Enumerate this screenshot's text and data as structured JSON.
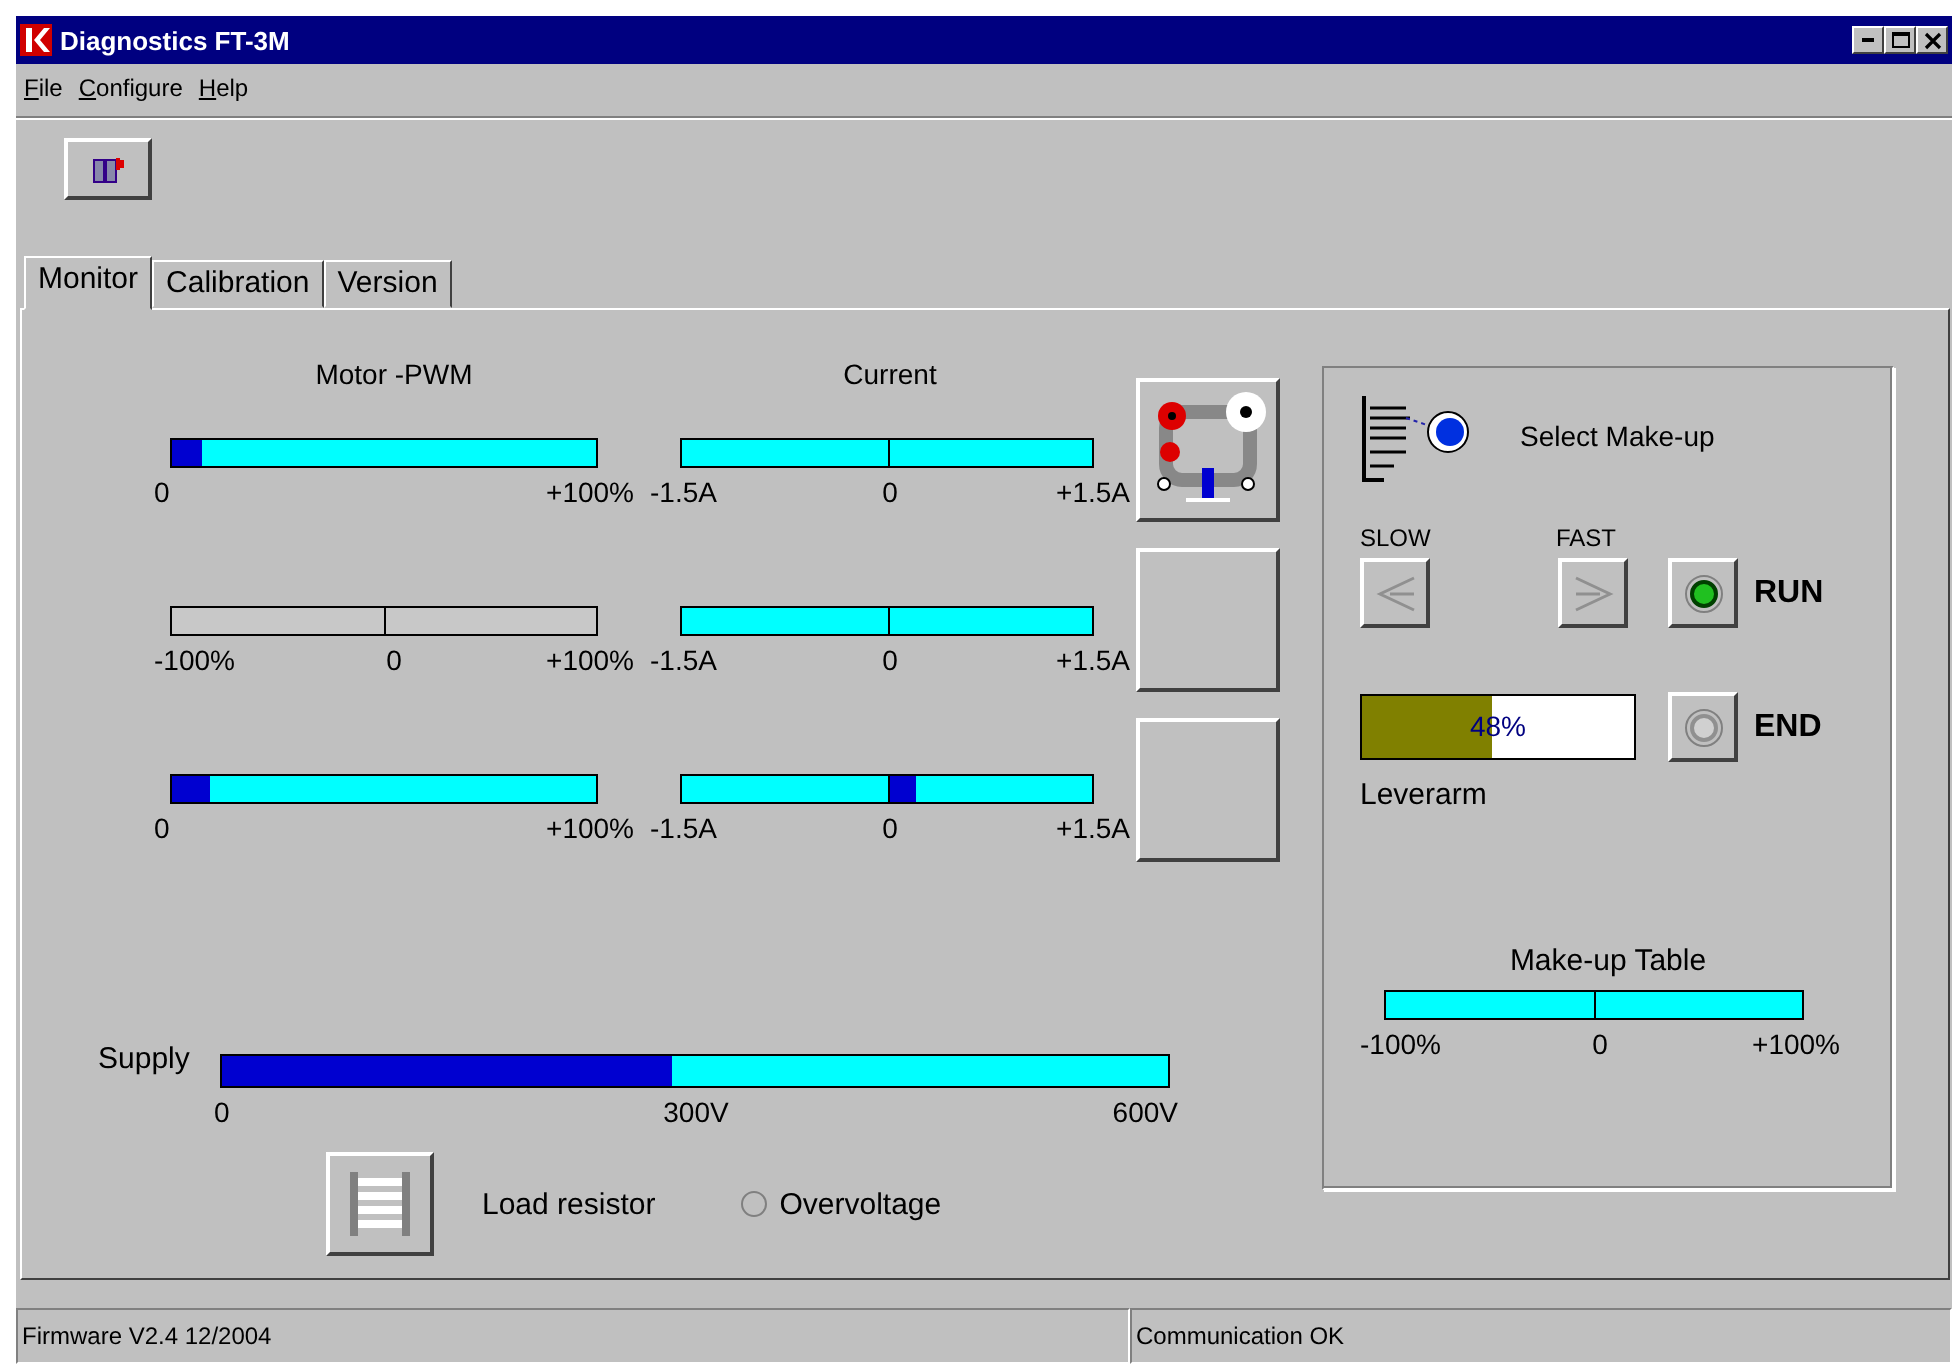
{
  "window": {
    "title": "Diagnostics FT-3M"
  },
  "menu": [
    {
      "label": "File"
    },
    {
      "label": "Configure"
    },
    {
      "label": "Help"
    }
  ],
  "tabs": [
    {
      "label": "Monitor",
      "selected": true
    },
    {
      "label": "Calibration",
      "selected": false
    },
    {
      "label": "Version",
      "selected": false
    }
  ],
  "motor_pwm": {
    "title": "Motor -PWM",
    "bars": [
      {
        "kind": "unipolar",
        "disabled": false,
        "level": 0.07,
        "scale": [
          "0",
          "+100%"
        ]
      },
      {
        "kind": "bipolar",
        "disabled": true,
        "scale": [
          "-100%",
          "0",
          "+100%"
        ]
      },
      {
        "kind": "unipolar",
        "disabled": false,
        "level": 0.09,
        "scale": [
          "0",
          "+100%"
        ]
      }
    ]
  },
  "current": {
    "title": "Current",
    "bars": [
      {
        "kind": "bipolar",
        "disabled": false,
        "level": 0.5,
        "scale": [
          "-1.5A",
          "0",
          "+1.5A"
        ]
      },
      {
        "kind": "bipolar",
        "disabled": false,
        "level": 0.5,
        "scale": [
          "-1.5A",
          "0",
          "+1.5A"
        ]
      },
      {
        "kind": "bipolar",
        "disabled": false,
        "level": 0.57,
        "scale": [
          "-1.5A",
          "0",
          "+1.5A"
        ]
      }
    ]
  },
  "motor_buttons": [
    {
      "kind": "motor"
    },
    {
      "kind": "blank"
    },
    {
      "kind": "blank"
    }
  ],
  "supply": {
    "label": "Supply",
    "level": 0.475,
    "scale": [
      "0",
      "300V",
      "600V"
    ]
  },
  "load_resistor": {
    "label": "Load resistor"
  },
  "overvoltage": {
    "label": "Overvoltage",
    "on": false
  },
  "makeup": {
    "select_label": "Select Make-up",
    "slow": "SLOW",
    "fast": "FAST",
    "run": {
      "label": "RUN",
      "on": true
    },
    "end": {
      "label": "END",
      "on": false
    },
    "leverarm": {
      "reading": "48%",
      "level": 0.48,
      "label": "Leverarm"
    },
    "table": {
      "title": "Make-up Table",
      "level": 0.5,
      "scale": [
        "-100%",
        "0",
        "+100%"
      ]
    }
  },
  "status_bar": [
    "Firmware V2.4 12/2004",
    "Communication OK"
  ]
}
